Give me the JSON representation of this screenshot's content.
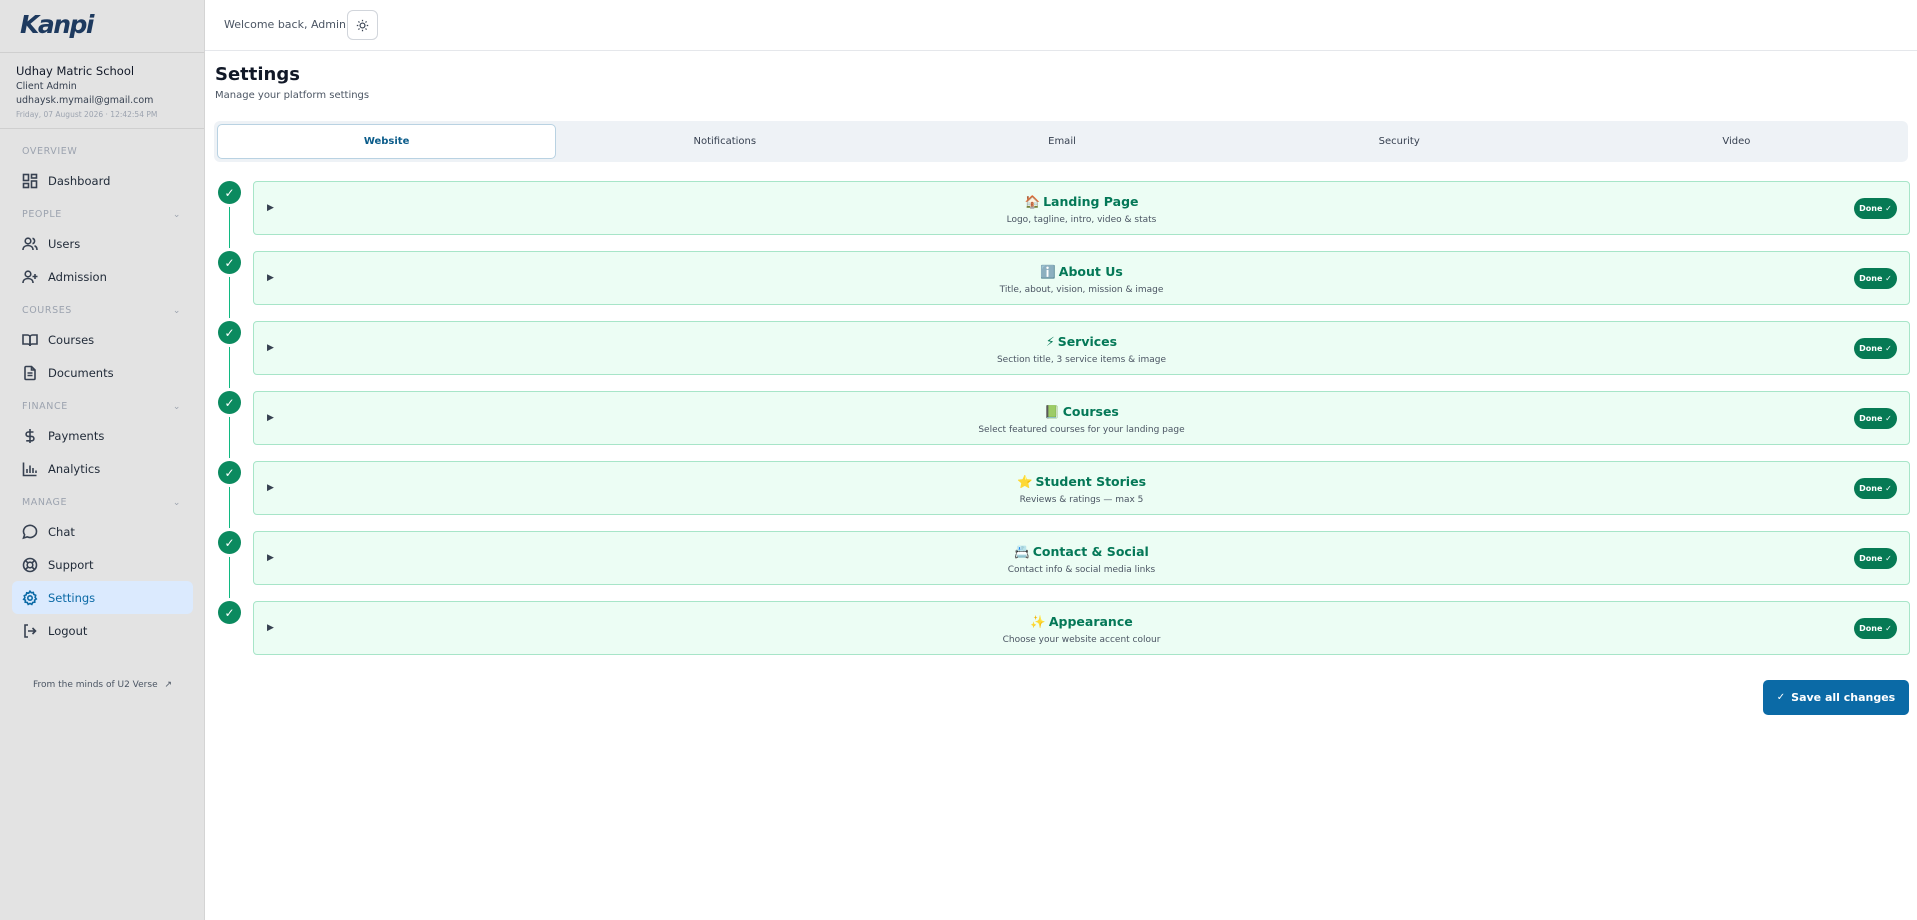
{
  "brand": {
    "logo": "Kanpi"
  },
  "profile": {
    "school": "Udhay Matric School",
    "role": "Client Admin",
    "email": "udhaysk.mymail@gmail.com",
    "datetime": "Friday, 07 August 2026 · 12:42:54 PM"
  },
  "nav": {
    "overview": "OVERVIEW",
    "dashboard": "Dashboard",
    "people": "PEOPLE",
    "users": "Users",
    "admission": "Admission",
    "courses_section": "COURSES",
    "courses": "Courses",
    "documents": "Documents",
    "finance": "FINANCE",
    "payments": "Payments",
    "analytics": "Analytics",
    "manage": "MANAGE",
    "chat": "Chat",
    "support": "Support",
    "settings": "Settings",
    "logout": "Logout"
  },
  "footer": {
    "link": "From the minds of U2 Verse"
  },
  "topbar": {
    "welcome": "Welcome back, Admin"
  },
  "page": {
    "title": "Settings",
    "subtitle": "Manage your platform settings"
  },
  "tabs": [
    "Website",
    "Notifications",
    "Email",
    "Security",
    "Video"
  ],
  "sections": [
    {
      "icon": "🏠",
      "title": "Landing Page",
      "desc": "Logo, tagline, intro, video & stats",
      "status": "Done ✓"
    },
    {
      "icon": "ℹ️",
      "title": "About Us",
      "desc": "Title, about, vision, mission & image",
      "status": "Done ✓"
    },
    {
      "icon": "⚡",
      "title": "Services",
      "desc": "Section title, 3 service items & image",
      "status": "Done ✓"
    },
    {
      "icon": "📗",
      "title": "Courses",
      "desc": "Select featured courses for your landing page",
      "status": "Done ✓"
    },
    {
      "icon": "⭐",
      "title": "Student Stories",
      "desc": "Reviews & ratings — max 5",
      "status": "Done ✓"
    },
    {
      "icon": "📇",
      "title": "Contact & Social",
      "desc": "Contact info & social media links",
      "status": "Done ✓"
    },
    {
      "icon": "✨",
      "title": "Appearance",
      "desc": "Choose your website accent colour",
      "status": "Done ✓"
    }
  ],
  "actions": {
    "save": "Save all changes"
  },
  "colors": {
    "accent": "#0b6aa6",
    "success": "#0b8a5f",
    "card_bg": "#ecfdf4"
  }
}
